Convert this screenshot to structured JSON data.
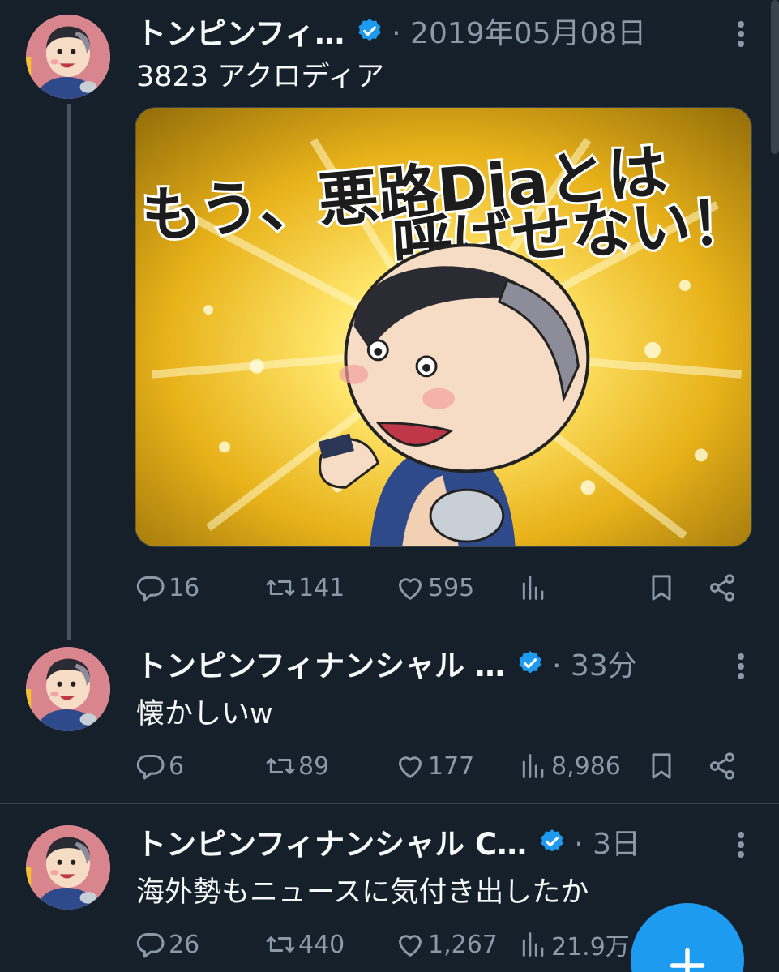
{
  "colors": {
    "background": "#15202b",
    "text_primary": "#f7f9f9",
    "text_secondary": "#8b98a5",
    "verified_blue": "#1d9bf0",
    "divider": "#38444d"
  },
  "tweets": [
    {
      "author": "トンピンフィ…",
      "verified": true,
      "meta": "· 2019年05月08日",
      "text": "3823 アクロディア",
      "media": {
        "caption_line1": "もう、悪路Diaとは",
        "caption_line2": "呼ばせない！"
      },
      "stats": {
        "replies": "16",
        "retweets": "141",
        "likes": "595",
        "views": ""
      }
    },
    {
      "author": "トンピンフィナンシャル …",
      "verified": true,
      "meta": "· 33分",
      "text": "懐かしいw",
      "stats": {
        "replies": "6",
        "retweets": "89",
        "likes": "177",
        "views": "8,986"
      }
    },
    {
      "author": "トンピンフィナンシャル C…",
      "verified": true,
      "meta": "· 3日",
      "text": "海外勢もニュースに気付き出したか",
      "stats": {
        "replies": "26",
        "retweets": "440",
        "likes": "1,267",
        "views": "21.9万"
      }
    }
  ],
  "icons": {
    "verified": "verified-badge-icon",
    "more": "more-options-icon",
    "reply": "reply-icon",
    "retweet": "retweet-icon",
    "like": "heart-icon",
    "views": "views-chart-icon",
    "bookmark": "bookmark-icon",
    "share": "share-icon",
    "compose": "plus-icon"
  }
}
